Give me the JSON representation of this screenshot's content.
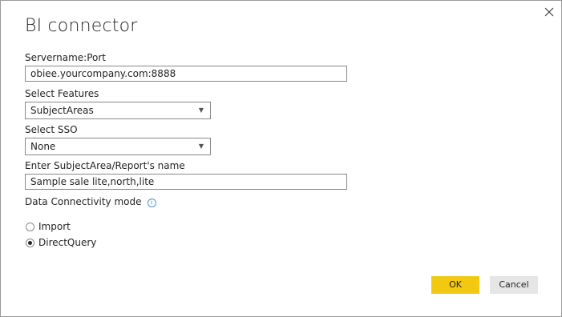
{
  "dialog": {
    "title": "BI connector",
    "close_icon": "close-icon"
  },
  "fields": {
    "servername": {
      "label": "Servername:Port",
      "value": "obiee.yourcompany.com:8888"
    },
    "features": {
      "label": "Select Features",
      "value": "SubjectAreas"
    },
    "sso": {
      "label": "Select SSO",
      "value": "None"
    },
    "subject_area": {
      "label": "Enter SubjectArea/Report's name",
      "value": "Sample sale lite,north,lite"
    }
  },
  "connectivity": {
    "label": "Data Connectivity mode",
    "info_icon": "info-icon",
    "options": [
      {
        "label": "Import",
        "selected": false
      },
      {
        "label": "DirectQuery",
        "selected": true
      }
    ]
  },
  "buttons": {
    "ok": "OK",
    "cancel": "Cancel"
  },
  "colors": {
    "accent": "#f2c811",
    "secondary_button": "#e6e6e6",
    "border": "#8a8886",
    "info": "#4a90d9"
  }
}
